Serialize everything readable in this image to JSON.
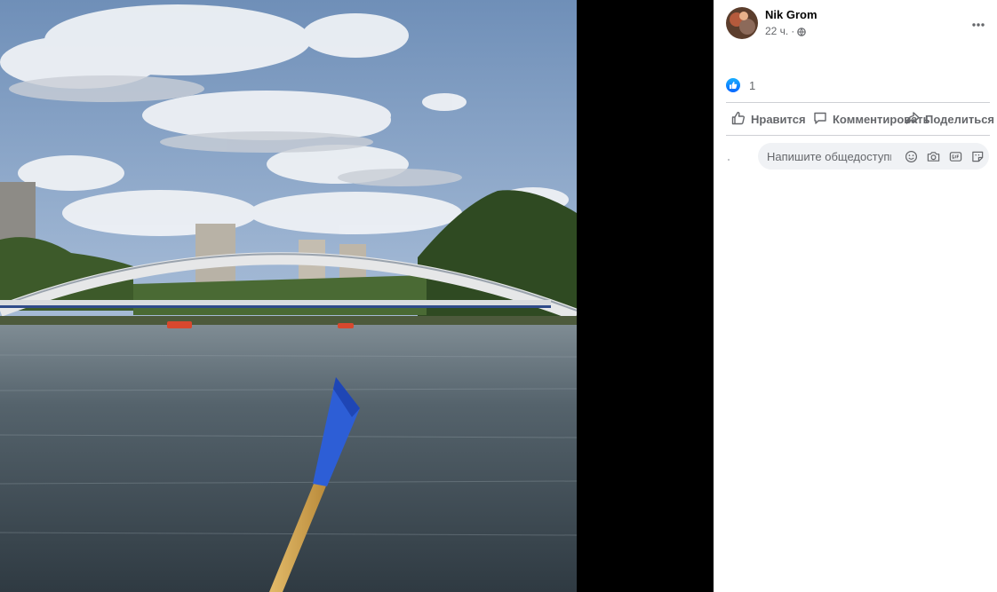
{
  "post": {
    "author": "Nik Grom",
    "timestamp": "22 ч.",
    "separator": "·",
    "audience_icon": "globe-icon",
    "more_icon": "more-horizontal-icon"
  },
  "reactions": {
    "icon": "like-icon",
    "count": "1"
  },
  "actions": {
    "like_label": "Нравится",
    "comment_label": "Комментировать",
    "share_label": "Поделиться"
  },
  "comment": {
    "placeholder": "Напишите общедоступный комментарий…",
    "tools": [
      "emoji-icon",
      "camera-icon",
      "gif-icon",
      "sticker-icon"
    ]
  },
  "photo": {
    "description_icon": "photo"
  },
  "colors": {
    "accent": "#0866ff",
    "secondary_text": "#65676b",
    "divider": "#ced0d4",
    "comment_bg": "#f0f2f5"
  }
}
